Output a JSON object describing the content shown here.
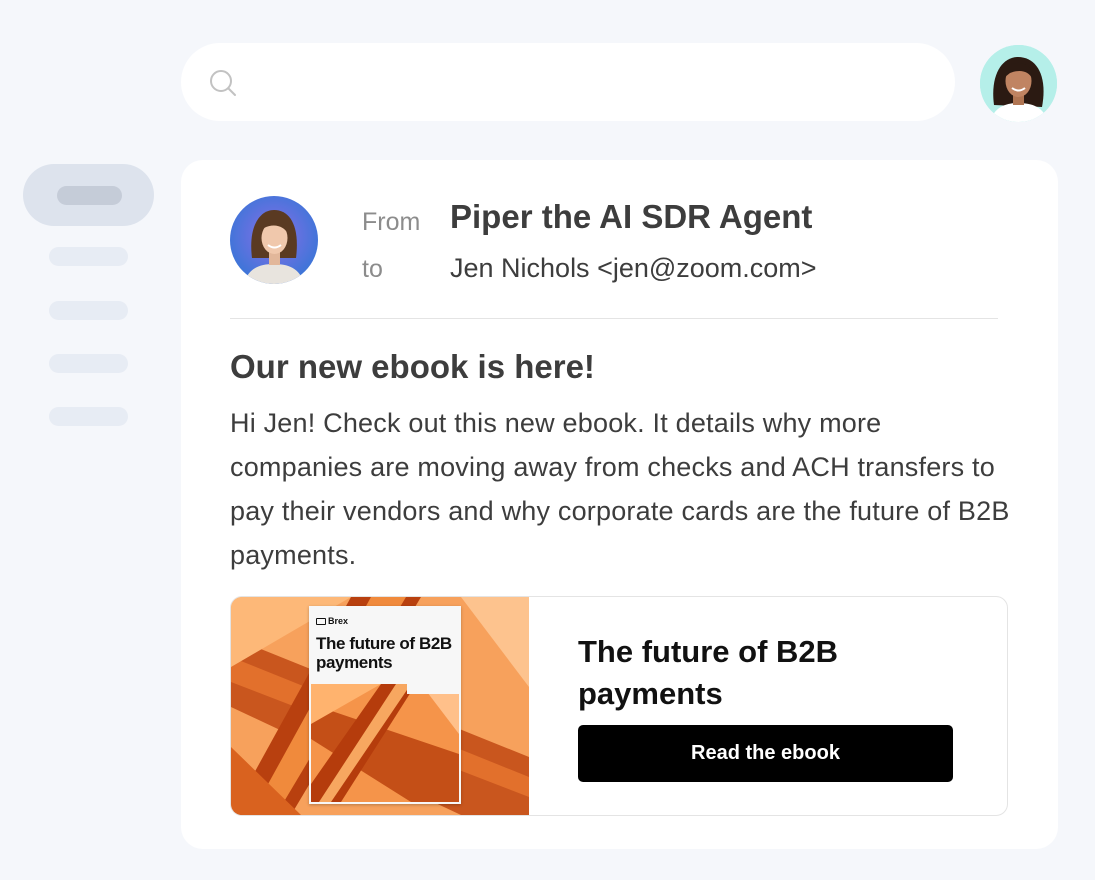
{
  "search": {
    "icon": "search-icon",
    "value": ""
  },
  "user": {
    "avatar_icon": "user-avatar-photo",
    "avatar_bg": "#b5efe9"
  },
  "email": {
    "from_label": "From",
    "to_label": "to",
    "sender": "Piper the AI SDR Agent",
    "recipient": "Jen Nichols <jen@zoom.com>",
    "subject": "Our new ebook is here!",
    "body": "Hi Jen! Check out this new ebook. It details why more companies are moving away from checks and ACH transfers to pay their vendors and why corporate cards are the future of B2B payments.",
    "avatar_icon": "sender-avatar-photo"
  },
  "ebook": {
    "brand": "Brex",
    "cover_title": "The future of B2B payments",
    "title": "The future of B2B payments",
    "button_label": "Read the ebook",
    "accent_color": "#f08a3c",
    "button_color": "#000000"
  }
}
